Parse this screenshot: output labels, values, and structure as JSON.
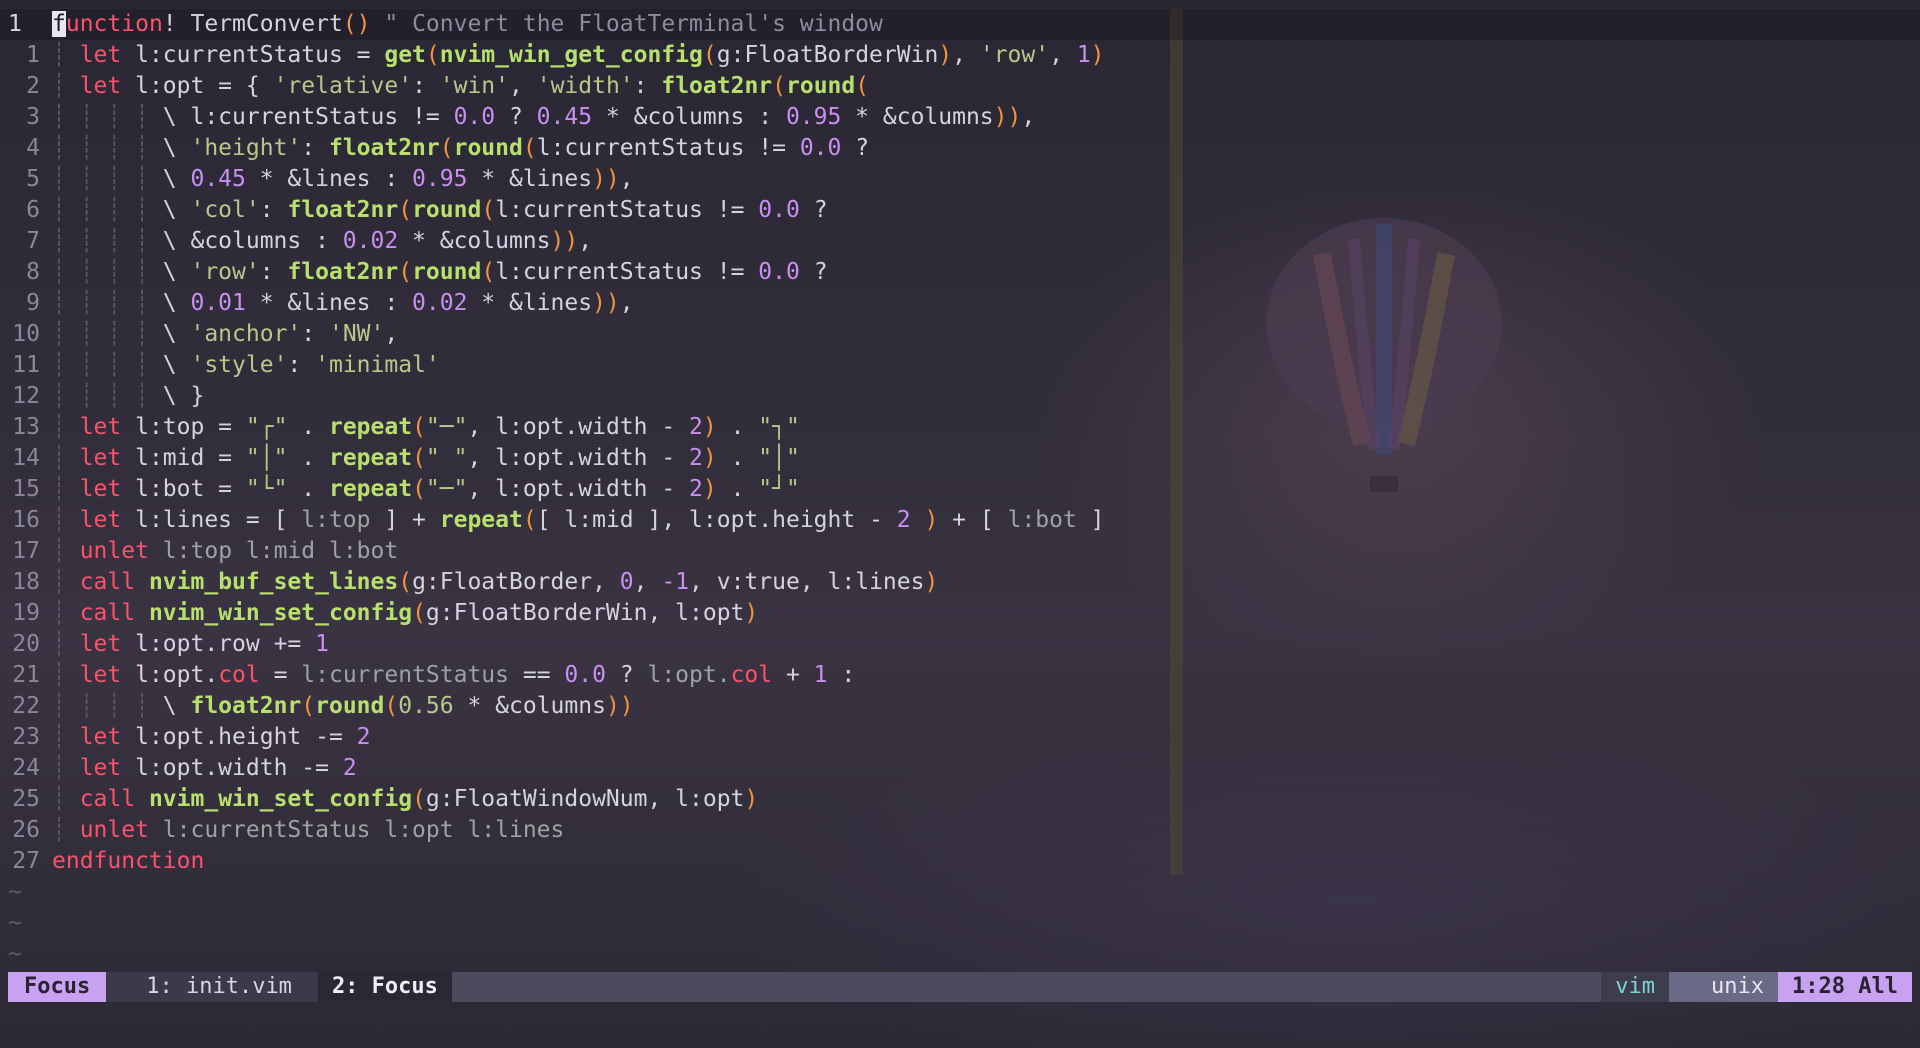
{
  "editor": {
    "current_line_number": "1",
    "lines": [
      {
        "n": "1",
        "seg": [
          {
            "t": "f",
            "c": "cursor"
          },
          {
            "t": "unction",
            "c": "kw"
          },
          {
            "t": "! ",
            "c": "var"
          },
          {
            "t": "TermConvert",
            "c": "var"
          },
          {
            "t": "()",
            "c": "paren"
          },
          {
            "t": " \" Convert the FloatTerminal's window",
            "c": "cmt"
          }
        ]
      },
      {
        "n": "1",
        "seg": [
          {
            "t": "┊ ",
            "c": "guide"
          },
          {
            "t": "let",
            "c": "kw"
          },
          {
            "t": " l:currentStatus = ",
            "c": "var"
          },
          {
            "t": "get",
            "c": "fn"
          },
          {
            "t": "(",
            "c": "paren"
          },
          {
            "t": "nvim_win_get_config",
            "c": "fn"
          },
          {
            "t": "(",
            "c": "paren"
          },
          {
            "t": "g:FloatBorderWin",
            "c": "var"
          },
          {
            "t": ")",
            "c": "paren"
          },
          {
            "t": ", ",
            "c": "var"
          },
          {
            "t": "'row'",
            "c": "str"
          },
          {
            "t": ", ",
            "c": "var"
          },
          {
            "t": "1",
            "c": "num-lit"
          },
          {
            "t": ")",
            "c": "paren"
          }
        ]
      },
      {
        "n": "2",
        "seg": [
          {
            "t": "┊ ",
            "c": "guide"
          },
          {
            "t": "let",
            "c": "kw"
          },
          {
            "t": " l:opt = { ",
            "c": "var"
          },
          {
            "t": "'relative'",
            "c": "str"
          },
          {
            "t": ": ",
            "c": "var"
          },
          {
            "t": "'win'",
            "c": "str"
          },
          {
            "t": ", ",
            "c": "var"
          },
          {
            "t": "'width'",
            "c": "str"
          },
          {
            "t": ": ",
            "c": "var"
          },
          {
            "t": "float2nr",
            "c": "fn"
          },
          {
            "t": "(",
            "c": "paren"
          },
          {
            "t": "round",
            "c": "fn"
          },
          {
            "t": "(",
            "c": "paren"
          }
        ]
      },
      {
        "n": "3",
        "seg": [
          {
            "t": "┊ ┊ ┊ ┊ ",
            "c": "guide"
          },
          {
            "t": "\\ l:currentStatus != ",
            "c": "var"
          },
          {
            "t": "0.0",
            "c": "num-lit"
          },
          {
            "t": " ? ",
            "c": "var"
          },
          {
            "t": "0.45",
            "c": "num-lit"
          },
          {
            "t": " * &columns : ",
            "c": "var"
          },
          {
            "t": "0.95",
            "c": "num-lit"
          },
          {
            "t": " * &columns",
            "c": "var"
          },
          {
            "t": "))",
            "c": "paren"
          },
          {
            "t": ",",
            "c": "var"
          }
        ]
      },
      {
        "n": "4",
        "seg": [
          {
            "t": "┊ ┊ ┊ ┊ ",
            "c": "guide"
          },
          {
            "t": "\\ ",
            "c": "var"
          },
          {
            "t": "'height'",
            "c": "str"
          },
          {
            "t": ": ",
            "c": "var"
          },
          {
            "t": "float2nr",
            "c": "fn"
          },
          {
            "t": "(",
            "c": "paren"
          },
          {
            "t": "round",
            "c": "fn"
          },
          {
            "t": "(",
            "c": "paren"
          },
          {
            "t": "l:currentStatus != ",
            "c": "var"
          },
          {
            "t": "0.0",
            "c": "num-lit"
          },
          {
            "t": " ?",
            "c": "var"
          }
        ]
      },
      {
        "n": "5",
        "seg": [
          {
            "t": "┊ ┊ ┊ ┊ ",
            "c": "guide"
          },
          {
            "t": "\\ ",
            "c": "var"
          },
          {
            "t": "0.45",
            "c": "num-lit"
          },
          {
            "t": " * &lines : ",
            "c": "var"
          },
          {
            "t": "0.95",
            "c": "num-lit"
          },
          {
            "t": " * &lines",
            "c": "var"
          },
          {
            "t": "))",
            "c": "paren"
          },
          {
            "t": ",",
            "c": "var"
          }
        ]
      },
      {
        "n": "6",
        "seg": [
          {
            "t": "┊ ┊ ┊ ┊ ",
            "c": "guide"
          },
          {
            "t": "\\ ",
            "c": "var"
          },
          {
            "t": "'col'",
            "c": "str"
          },
          {
            "t": ": ",
            "c": "var"
          },
          {
            "t": "float2nr",
            "c": "fn"
          },
          {
            "t": "(",
            "c": "paren"
          },
          {
            "t": "round",
            "c": "fn"
          },
          {
            "t": "(",
            "c": "paren"
          },
          {
            "t": "l:currentStatus != ",
            "c": "var"
          },
          {
            "t": "0.0",
            "c": "num-lit"
          },
          {
            "t": " ?",
            "c": "var"
          }
        ]
      },
      {
        "n": "7",
        "seg": [
          {
            "t": "┊ ┊ ┊ ┊ ",
            "c": "guide"
          },
          {
            "t": "\\ &columns : ",
            "c": "var"
          },
          {
            "t": "0.02",
            "c": "num-lit"
          },
          {
            "t": " * &columns",
            "c": "var"
          },
          {
            "t": "))",
            "c": "paren"
          },
          {
            "t": ",",
            "c": "var"
          }
        ]
      },
      {
        "n": "8",
        "seg": [
          {
            "t": "┊ ┊ ┊ ┊ ",
            "c": "guide"
          },
          {
            "t": "\\ ",
            "c": "var"
          },
          {
            "t": "'row'",
            "c": "str"
          },
          {
            "t": ": ",
            "c": "var"
          },
          {
            "t": "float2nr",
            "c": "fn"
          },
          {
            "t": "(",
            "c": "paren"
          },
          {
            "t": "round",
            "c": "fn"
          },
          {
            "t": "(",
            "c": "paren"
          },
          {
            "t": "l:currentStatus != ",
            "c": "var"
          },
          {
            "t": "0.0",
            "c": "num-lit"
          },
          {
            "t": " ?",
            "c": "var"
          }
        ]
      },
      {
        "n": "9",
        "seg": [
          {
            "t": "┊ ┊ ┊ ┊ ",
            "c": "guide"
          },
          {
            "t": "\\ ",
            "c": "var"
          },
          {
            "t": "0.01",
            "c": "num-lit"
          },
          {
            "t": " * &lines : ",
            "c": "var"
          },
          {
            "t": "0.02",
            "c": "num-lit"
          },
          {
            "t": " * &lines",
            "c": "var"
          },
          {
            "t": "))",
            "c": "paren"
          },
          {
            "t": ",",
            "c": "var"
          }
        ]
      },
      {
        "n": "10",
        "seg": [
          {
            "t": "┊ ┊ ┊ ┊ ",
            "c": "guide"
          },
          {
            "t": "\\ ",
            "c": "var"
          },
          {
            "t": "'anchor'",
            "c": "str"
          },
          {
            "t": ": ",
            "c": "var"
          },
          {
            "t": "'NW'",
            "c": "str"
          },
          {
            "t": ",",
            "c": "var"
          }
        ]
      },
      {
        "n": "11",
        "seg": [
          {
            "t": "┊ ┊ ┊ ┊ ",
            "c": "guide"
          },
          {
            "t": "\\ ",
            "c": "var"
          },
          {
            "t": "'style'",
            "c": "str"
          },
          {
            "t": ": ",
            "c": "var"
          },
          {
            "t": "'minimal'",
            "c": "str"
          }
        ]
      },
      {
        "n": "12",
        "seg": [
          {
            "t": "┊ ┊ ┊ ┊ ",
            "c": "guide"
          },
          {
            "t": "\\ }",
            "c": "var"
          }
        ]
      },
      {
        "n": "13",
        "seg": [
          {
            "t": "┊ ",
            "c": "guide"
          },
          {
            "t": "let",
            "c": "kw"
          },
          {
            "t": " l:top = ",
            "c": "var"
          },
          {
            "t": "\"┌\"",
            "c": "str"
          },
          {
            "t": " . ",
            "c": "var"
          },
          {
            "t": "repeat",
            "c": "fn"
          },
          {
            "t": "(",
            "c": "paren"
          },
          {
            "t": "\"─\"",
            "c": "str"
          },
          {
            "t": ", l:opt.width - ",
            "c": "var"
          },
          {
            "t": "2",
            "c": "num-lit"
          },
          {
            "t": ")",
            "c": "paren"
          },
          {
            "t": " . ",
            "c": "var"
          },
          {
            "t": "\"┐\"",
            "c": "str"
          }
        ]
      },
      {
        "n": "14",
        "seg": [
          {
            "t": "┊ ",
            "c": "guide"
          },
          {
            "t": "let",
            "c": "kw"
          },
          {
            "t": " l:mid = ",
            "c": "var"
          },
          {
            "t": "\"│\"",
            "c": "str"
          },
          {
            "t": " . ",
            "c": "var"
          },
          {
            "t": "repeat",
            "c": "fn"
          },
          {
            "t": "(",
            "c": "paren"
          },
          {
            "t": "\" \"",
            "c": "str"
          },
          {
            "t": ", l:opt.width - ",
            "c": "var"
          },
          {
            "t": "2",
            "c": "num-lit"
          },
          {
            "t": ")",
            "c": "paren"
          },
          {
            "t": " . ",
            "c": "var"
          },
          {
            "t": "\"│\"",
            "c": "str"
          }
        ]
      },
      {
        "n": "15",
        "seg": [
          {
            "t": "┊ ",
            "c": "guide"
          },
          {
            "t": "let",
            "c": "kw"
          },
          {
            "t": " l:bot = ",
            "c": "var"
          },
          {
            "t": "\"└\"",
            "c": "str"
          },
          {
            "t": " . ",
            "c": "var"
          },
          {
            "t": "repeat",
            "c": "fn"
          },
          {
            "t": "(",
            "c": "paren"
          },
          {
            "t": "\"─\"",
            "c": "str"
          },
          {
            "t": ", l:opt.width - ",
            "c": "var"
          },
          {
            "t": "2",
            "c": "num-lit"
          },
          {
            "t": ")",
            "c": "paren"
          },
          {
            "t": " . ",
            "c": "var"
          },
          {
            "t": "\"┘\"",
            "c": "str"
          }
        ]
      },
      {
        "n": "16",
        "seg": [
          {
            "t": "┊ ",
            "c": "guide"
          },
          {
            "t": "let",
            "c": "kw"
          },
          {
            "t": " l:lines = [ ",
            "c": "var"
          },
          {
            "t": "l:top",
            "c": "dim"
          },
          {
            "t": " ] + ",
            "c": "var"
          },
          {
            "t": "repeat",
            "c": "fn"
          },
          {
            "t": "(",
            "c": "paren"
          },
          {
            "t": "[ l:mid ], l:opt.height - ",
            "c": "var"
          },
          {
            "t": "2",
            "c": "num-lit"
          },
          {
            "t": " )",
            "c": "paren"
          },
          {
            "t": " + [ ",
            "c": "var"
          },
          {
            "t": "l:bot",
            "c": "dim"
          },
          {
            "t": " ]",
            "c": "var"
          }
        ]
      },
      {
        "n": "17",
        "seg": [
          {
            "t": "┊ ",
            "c": "guide"
          },
          {
            "t": "unlet",
            "c": "kw"
          },
          {
            "t": " l:top l:mid l:bot",
            "c": "dim"
          }
        ]
      },
      {
        "n": "18",
        "seg": [
          {
            "t": "┊ ",
            "c": "guide"
          },
          {
            "t": "call",
            "c": "kw"
          },
          {
            "t": " ",
            "c": "var"
          },
          {
            "t": "nvim_buf_set_lines",
            "c": "fn"
          },
          {
            "t": "(",
            "c": "paren"
          },
          {
            "t": "g:FloatBorder, ",
            "c": "var"
          },
          {
            "t": "0",
            "c": "num-lit"
          },
          {
            "t": ", ",
            "c": "var"
          },
          {
            "t": "-1",
            "c": "num-lit"
          },
          {
            "t": ", v:true, l:lines",
            "c": "var"
          },
          {
            "t": ")",
            "c": "paren"
          }
        ]
      },
      {
        "n": "19",
        "seg": [
          {
            "t": "┊ ",
            "c": "guide"
          },
          {
            "t": "call",
            "c": "kw"
          },
          {
            "t": " ",
            "c": "var"
          },
          {
            "t": "nvim_win_set_config",
            "c": "fn"
          },
          {
            "t": "(",
            "c": "paren"
          },
          {
            "t": "g:FloatBorderWin, l:opt",
            "c": "var"
          },
          {
            "t": ")",
            "c": "paren"
          }
        ]
      },
      {
        "n": "20",
        "seg": [
          {
            "t": "┊ ",
            "c": "guide"
          },
          {
            "t": "let",
            "c": "kw"
          },
          {
            "t": " l:opt.row += ",
            "c": "var"
          },
          {
            "t": "1",
            "c": "num-lit"
          }
        ]
      },
      {
        "n": "21",
        "seg": [
          {
            "t": "┊ ",
            "c": "guide"
          },
          {
            "t": "let",
            "c": "kw"
          },
          {
            "t": " l:opt.",
            "c": "var"
          },
          {
            "t": "col",
            "c": "kw"
          },
          {
            "t": " = ",
            "c": "var"
          },
          {
            "t": "l:currentStatus",
            "c": "dim"
          },
          {
            "t": " == ",
            "c": "var"
          },
          {
            "t": "0.0",
            "c": "num-lit"
          },
          {
            "t": " ? ",
            "c": "var"
          },
          {
            "t": "l:opt.",
            "c": "dim"
          },
          {
            "t": "col",
            "c": "kw"
          },
          {
            "t": " + ",
            "c": "var"
          },
          {
            "t": "1",
            "c": "num-lit"
          },
          {
            "t": " :",
            "c": "var"
          }
        ]
      },
      {
        "n": "22",
        "seg": [
          {
            "t": "┊ ┊ ┊ ┊ ",
            "c": "guide"
          },
          {
            "t": "\\ ",
            "c": "var"
          },
          {
            "t": "float2nr",
            "c": "fn"
          },
          {
            "t": "(",
            "c": "paren"
          },
          {
            "t": "round",
            "c": "fn"
          },
          {
            "t": "(",
            "c": "paren"
          },
          {
            "t": "0.56",
            "c": "str"
          },
          {
            "t": " * &columns",
            "c": "var"
          },
          {
            "t": "))",
            "c": "paren"
          }
        ]
      },
      {
        "n": "23",
        "seg": [
          {
            "t": "┊ ",
            "c": "guide"
          },
          {
            "t": "let",
            "c": "kw"
          },
          {
            "t": " l:opt.height -= ",
            "c": "var"
          },
          {
            "t": "2",
            "c": "num-lit"
          }
        ]
      },
      {
        "n": "24",
        "seg": [
          {
            "t": "┊ ",
            "c": "guide"
          },
          {
            "t": "let",
            "c": "kw"
          },
          {
            "t": " l:opt.width -= ",
            "c": "var"
          },
          {
            "t": "2",
            "c": "num-lit"
          }
        ]
      },
      {
        "n": "25",
        "seg": [
          {
            "t": "┊ ",
            "c": "guide"
          },
          {
            "t": "call",
            "c": "kw"
          },
          {
            "t": " ",
            "c": "var"
          },
          {
            "t": "nvim_win_set_config",
            "c": "fn"
          },
          {
            "t": "(",
            "c": "paren"
          },
          {
            "t": "g:FloatWindowNum, l:opt",
            "c": "var"
          },
          {
            "t": ")",
            "c": "paren"
          }
        ]
      },
      {
        "n": "26",
        "seg": [
          {
            "t": "┊ ",
            "c": "guide"
          },
          {
            "t": "unlet",
            "c": "kw"
          },
          {
            "t": " l:currentStatus l:opt l:lines",
            "c": "dim"
          }
        ]
      },
      {
        "n": "27",
        "seg": [
          {
            "t": "endfunction",
            "c": "kw"
          }
        ]
      }
    ],
    "tildes": [
      "~",
      "~",
      "~"
    ]
  },
  "statusline": {
    "mode": "Focus",
    "tab1": "1: init.vim",
    "tab2": "2: Focus",
    "filetype": "vim",
    "fileformat": "unix",
    "position": "1:28 All"
  }
}
